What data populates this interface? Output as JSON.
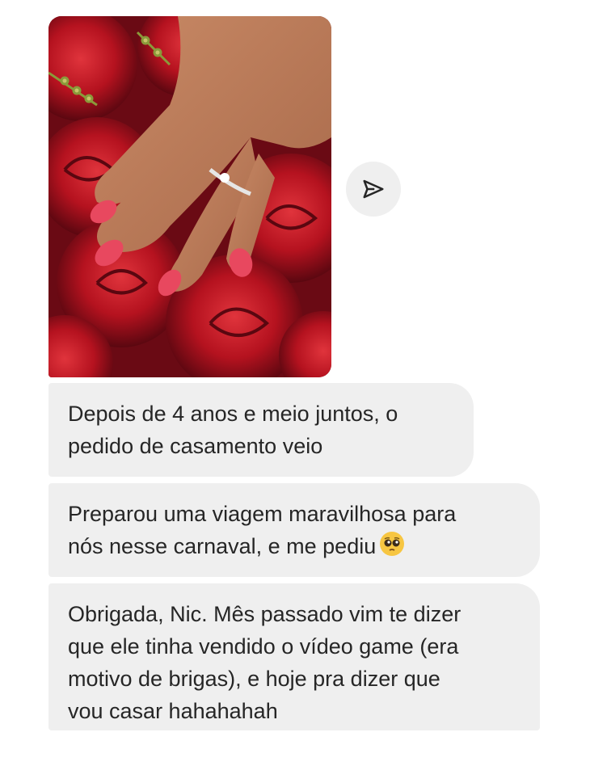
{
  "attachment": {
    "type": "photo",
    "icons": {
      "share": "paper-plane-icon"
    }
  },
  "messages": [
    {
      "lines": [
        "Depois de 4 anos e meio juntos, o",
        "pedido de casamento veio"
      ]
    },
    {
      "lines": [
        "Preparou uma viagem maravilhosa para",
        "nós nesse carnaval, e me pediu"
      ],
      "emoji": "pleading-face-icon"
    },
    {
      "lines": [
        "Obrigada, Nic. Mês passado vim te dizer",
        "que ele tinha vendido o vídeo game (era",
        "motivo de brigas), e hoje pra dizer que",
        "vou casar hahahahah"
      ]
    }
  ],
  "colors": {
    "bubble_bg": "#efefef",
    "text": "#262626",
    "nail": "#e8485f",
    "roses": "#a3101c"
  }
}
